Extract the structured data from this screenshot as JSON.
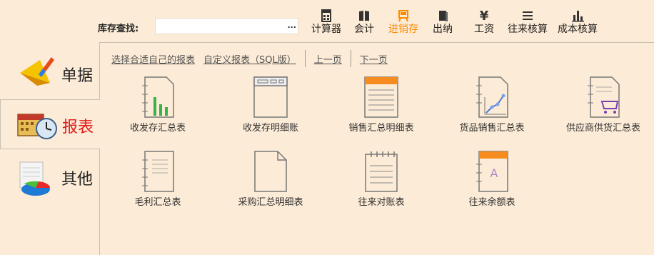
{
  "search": {
    "label": "库存查找:",
    "value": "",
    "button": "..."
  },
  "toolbar": [
    {
      "label": "计算器",
      "icon": "calculator-icon"
    },
    {
      "label": "会计",
      "icon": "book-icon"
    },
    {
      "label": "进销存",
      "icon": "cart-icon",
      "active": true
    },
    {
      "label": "出纳",
      "icon": "document-icon"
    },
    {
      "label": "工资",
      "icon": "yen-icon"
    },
    {
      "label": "往来核算",
      "icon": "list-icon"
    },
    {
      "label": "成本核算",
      "icon": "bar-chart-icon"
    }
  ],
  "tabs": [
    {
      "label": "单据",
      "icon": "pen-icon"
    },
    {
      "label": "报表",
      "icon": "calendar-clock-icon",
      "active": true
    },
    {
      "label": "其他",
      "icon": "pie-chart-icon"
    }
  ],
  "links": {
    "choose": "选择合适自己的报表",
    "custom": "自定义报表（SQL版）",
    "prev": "上一页",
    "next": "下一页"
  },
  "reports": [
    {
      "label": "收发存汇总表",
      "icon": "green-bar-report-icon"
    },
    {
      "label": "收发存明细账",
      "icon": "window-report-icon"
    },
    {
      "label": "销售汇总明细表",
      "icon": "orange-lined-report-icon"
    },
    {
      "label": "货品销售汇总表",
      "icon": "line-chart-report-icon"
    },
    {
      "label": "供应商供货汇总表",
      "icon": "cart-report-icon"
    },
    {
      "label": "毛利汇总表",
      "icon": "notebook-report-icon"
    },
    {
      "label": "采购汇总明细表",
      "icon": "blank-report-icon"
    },
    {
      "label": "往来对账表",
      "icon": "spiral-report-icon"
    },
    {
      "label": "往来余额表",
      "icon": "letter-a-report-icon"
    }
  ],
  "colors": {
    "accent": "#ff8a00",
    "active_tab": "#e21a1a",
    "background": "#fcebd6"
  }
}
